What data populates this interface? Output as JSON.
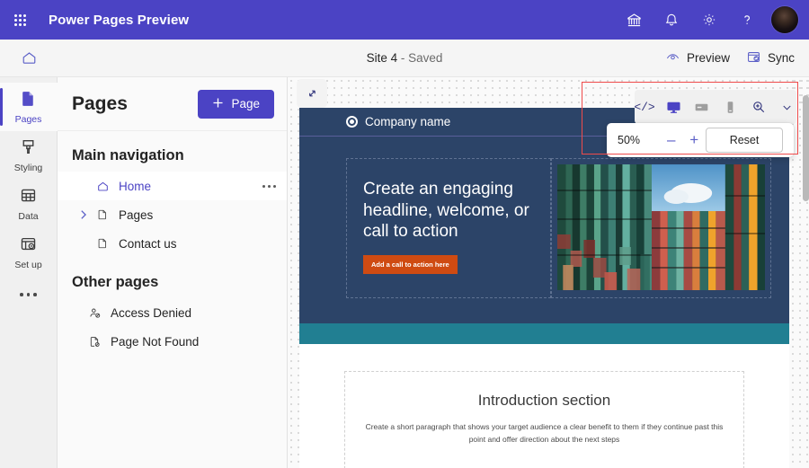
{
  "topbar": {
    "waffle_icon": "app-launcher-icon",
    "title": "Power Pages Preview",
    "actions": [
      {
        "icon": "globe-accessibility-icon",
        "name": "accessibility-button"
      },
      {
        "icon": "bell-icon",
        "name": "notifications-button"
      },
      {
        "icon": "gear-icon",
        "name": "settings-button"
      },
      {
        "icon": "question-mark-icon",
        "name": "help-button"
      }
    ],
    "avatar": "user-avatar",
    "brand_color": "#4b43c4"
  },
  "commandbar": {
    "home_icon": "home-icon",
    "site_name": "Site 4",
    "save_state": "- Saved",
    "preview_label": "Preview",
    "preview_icon": "eye-icon",
    "sync_label": "Sync",
    "sync_icon": "sync-window-icon"
  },
  "rail": {
    "items": [
      {
        "label": "Pages",
        "icon": "page-icon",
        "active": true
      },
      {
        "label": "Styling",
        "icon": "paint-brush-icon",
        "active": false
      },
      {
        "label": "Data",
        "icon": "table-grid-icon",
        "active": false
      },
      {
        "label": "Set up",
        "icon": "setup-gear-panel-icon",
        "active": false
      }
    ],
    "more_label": "more-options"
  },
  "panel": {
    "title": "Pages",
    "add_button": "Page",
    "add_icon": "plus-icon",
    "sections": [
      {
        "heading": "Main navigation",
        "items": [
          {
            "label": "Home",
            "icon": "home-icon",
            "selected": true,
            "expandable": false,
            "has_overflow": true
          },
          {
            "label": "Pages",
            "icon": "document-icon",
            "selected": false,
            "expandable": true,
            "has_overflow": false
          },
          {
            "label": "Contact us",
            "icon": "document-icon",
            "selected": false,
            "expandable": false,
            "has_overflow": false
          }
        ]
      },
      {
        "heading": "Other pages",
        "items": [
          {
            "label": "Access Denied",
            "icon": "person-blocked-icon",
            "selected": false,
            "expandable": false,
            "has_overflow": false
          },
          {
            "label": "Page Not Found",
            "icon": "document-blocked-icon",
            "selected": false,
            "expandable": false,
            "has_overflow": false
          }
        ]
      }
    ]
  },
  "canvas": {
    "expand_icon": "expand-diagonal-icon",
    "site": {
      "company_name": "Company name",
      "logo_icon": "circle-logo-icon",
      "hero_heading": "Create an engaging headline, welcome, or call to action",
      "cta_label": "Add a call to action here",
      "cta_color": "#cf4b12",
      "hero_bg": "#2c4468",
      "accent_strip": "#217f92",
      "image_alt": "colorful-shipping-containers-photo",
      "intro_title": "Introduction section",
      "intro_text": "Create a short paragraph that shows your target audience a clear benefit to them if they continue past this point and offer direction about the next steps"
    }
  },
  "toolbar": {
    "devices": [
      {
        "icon": "code-icon",
        "name": "view-code-button",
        "active": false
      },
      {
        "icon": "desktop-icon",
        "name": "desktop-view-button",
        "active": true
      },
      {
        "icon": "tablet-icon",
        "name": "tablet-view-button",
        "active": false
      },
      {
        "icon": "mobile-icon",
        "name": "mobile-view-button",
        "active": false
      },
      {
        "icon": "magnifier-plus-icon",
        "name": "zoom-button",
        "active": false
      },
      {
        "icon": "chevron-down-icon",
        "name": "zoom-dropdown-button",
        "active": false
      }
    ],
    "zoom": {
      "level": "50%",
      "minus_label": "–",
      "plus_label": "+",
      "reset_label": "Reset"
    },
    "highlight_color": "#ef4b4b"
  }
}
